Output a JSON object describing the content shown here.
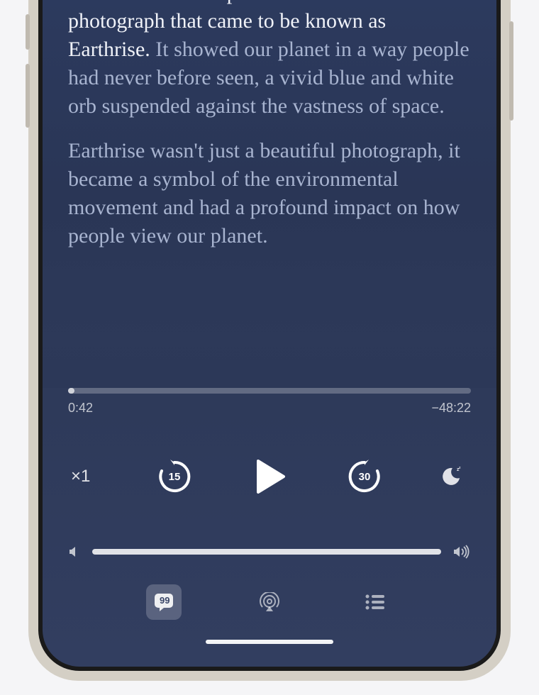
{
  "transcript": {
    "para1_start": "William Anders captured the moment in a photograph that came to be known as Earthrise.",
    "para1_end": " It showed our planet in a way people had never before seen, a vivid blue and white orb suspended against the vastness of space.",
    "para2": "Earthrise wasn't just a beautiful photograph, it became a symbol of the environmental movement and had a profound impact on how people view our planet."
  },
  "playback": {
    "elapsed": "0:42",
    "remaining": "−48:22",
    "speed": "×1",
    "skip_back": "15",
    "skip_forward": "30"
  }
}
